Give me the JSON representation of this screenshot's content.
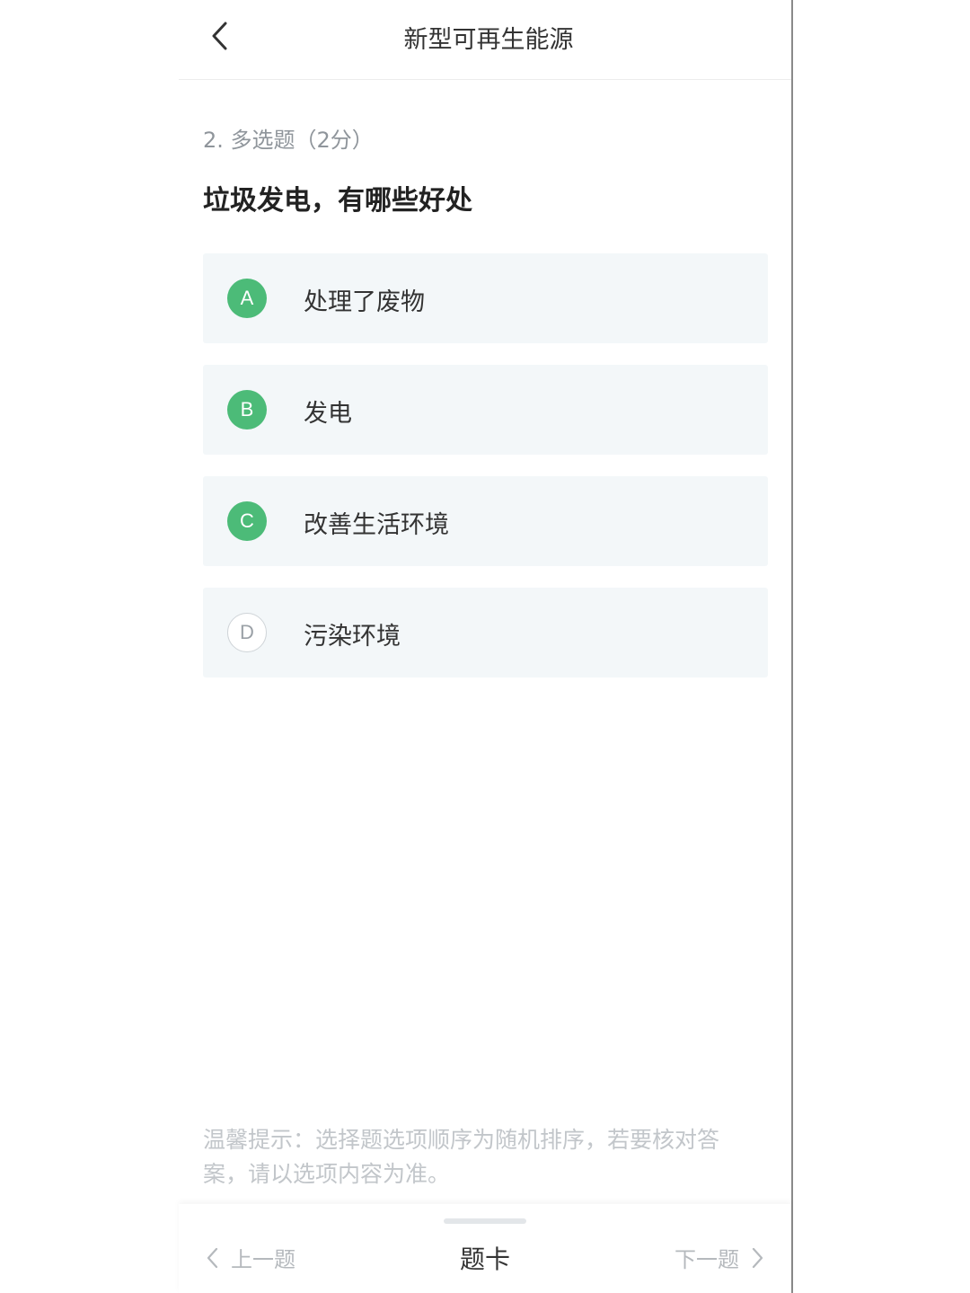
{
  "header": {
    "title": "新型可再生能源"
  },
  "question": {
    "type_label": "2. 多选题（2分）",
    "text": "垃圾发电，有哪些好处"
  },
  "options": [
    {
      "letter": "A",
      "text": "处理了废物",
      "selected": true
    },
    {
      "letter": "B",
      "text": "发电",
      "selected": true
    },
    {
      "letter": "C",
      "text": "改善生活环境",
      "selected": true
    },
    {
      "letter": "D",
      "text": "污染环境",
      "selected": false
    }
  ],
  "tip": "温馨提示：选择题选项顺序为随机排序，若要核对答案，请以选项内容为准。",
  "footer": {
    "prev_label": "上一题",
    "card_label": "题卡",
    "next_label": "下一题"
  },
  "colors": {
    "accent": "#4cbb78",
    "option_bg": "#f3f7f9"
  }
}
